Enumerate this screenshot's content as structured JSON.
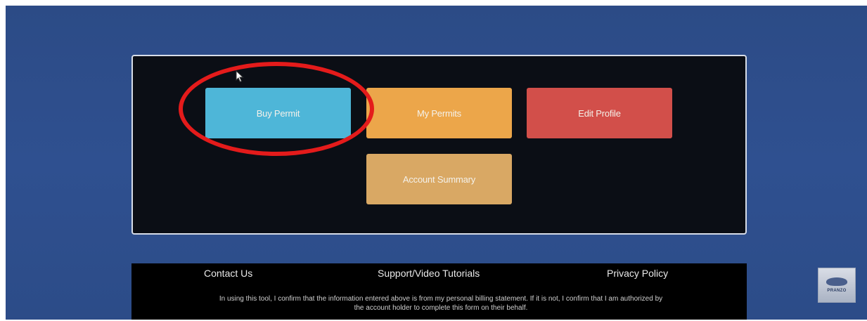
{
  "dashboard": {
    "buttons": {
      "buy_permit": "Buy Permit",
      "my_permits": "My Permits",
      "edit_profile": "Edit Profile",
      "account_summary": "Account Summary"
    },
    "colors": {
      "buy_permit": "#4eb6d8",
      "my_permits": "#eca64a",
      "edit_profile": "#d24f4a",
      "account_summary": "#d9a864",
      "highlight": "#e41b1b"
    }
  },
  "footer": {
    "links": {
      "contact": "Contact Us",
      "support": "Support/Video Tutorials",
      "privacy": "Privacy Policy"
    },
    "note": "In using this tool, I confirm that the information entered above is from my personal billing statement. If it is not, I confirm that I am authorized by the account holder to complete this form on their behalf."
  },
  "icons": {
    "cursor": "mouse-pointer-icon",
    "watermark": "channel-logo-icon"
  },
  "watermark": {
    "label": "PRANZO"
  }
}
